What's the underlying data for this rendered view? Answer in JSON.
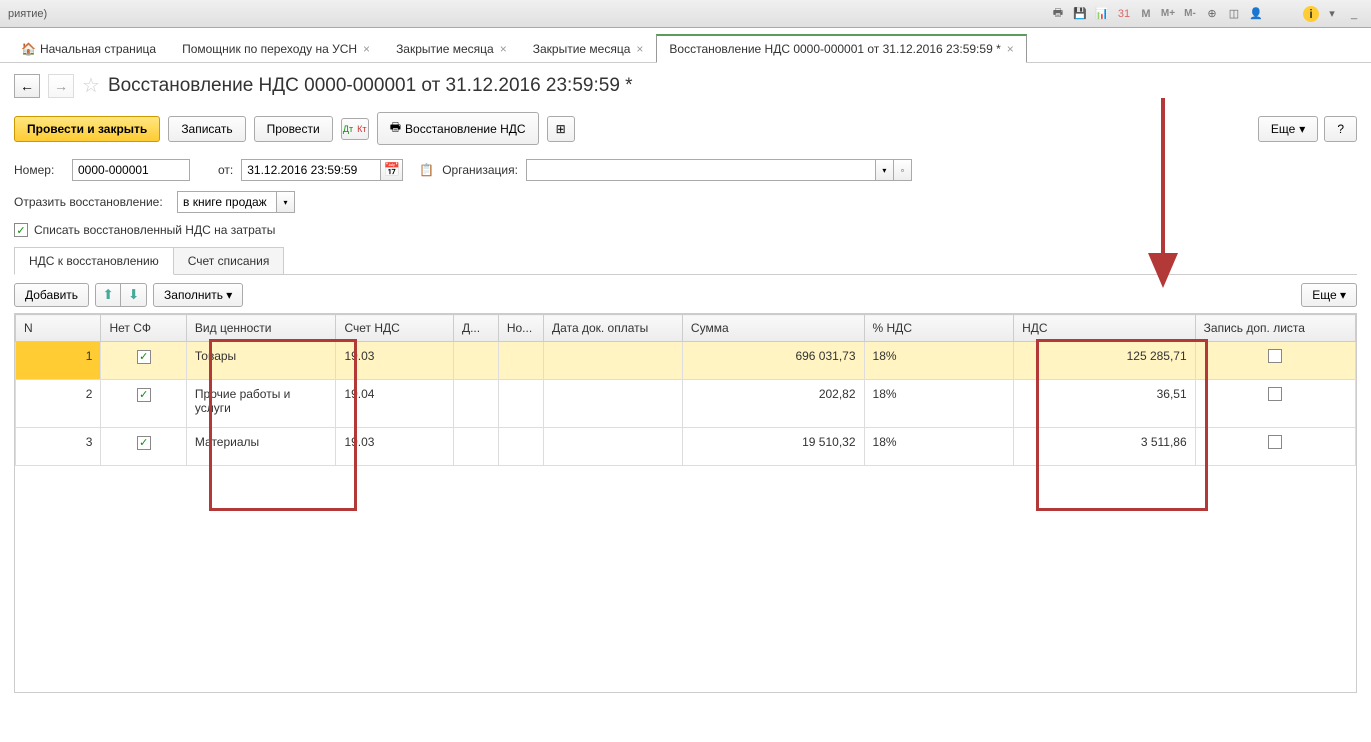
{
  "top": {
    "title_fragment": "риятие)"
  },
  "tabs": {
    "home": "Начальная страница",
    "items": [
      {
        "label": "Помощник по переходу на УСН"
      },
      {
        "label": "Закрытие месяца"
      },
      {
        "label": "Закрытие месяца"
      },
      {
        "label": "Восстановление НДС 0000-000001 от 31.12.2016 23:59:59 *",
        "active": true
      }
    ]
  },
  "title": "Восстановление НДС 0000-000001 от 31.12.2016 23:59:59 *",
  "toolbar": {
    "post_close": "Провести и закрыть",
    "save": "Записать",
    "post": "Провести",
    "print": "Восстановление НДС",
    "more": "Еще",
    "help": "?"
  },
  "form": {
    "number_label": "Номер:",
    "number_value": "0000-000001",
    "date_label": "от:",
    "date_value": "31.12.2016 23:59:59",
    "org_label": "Организация:",
    "org_value": "",
    "reflect_label": "Отразить восстановление:",
    "reflect_value": "в книге продаж",
    "write_off_label": "Списать восстановленный НДС на затраты"
  },
  "subtabs": {
    "tab1": "НДС к восстановлению",
    "tab2": "Счет списания"
  },
  "table_toolbar": {
    "add": "Добавить",
    "fill": "Заполнить",
    "more": "Еще"
  },
  "table": {
    "headers": {
      "n": "N",
      "sf": "Нет СФ",
      "vid": "Вид ценности",
      "schet": "Счет НДС",
      "d": "Д...",
      "no": "Но...",
      "date": "Дата док. оплаты",
      "sum": "Сумма",
      "pct": "% НДС",
      "nds": "НДС",
      "dop": "Запись доп. листа"
    },
    "rows": [
      {
        "n": "1",
        "sf": true,
        "vid": "Товары",
        "schet": "19.03",
        "sum": "696 031,73",
        "pct": "18%",
        "nds": "125 285,71",
        "dop": false,
        "selected": true
      },
      {
        "n": "2",
        "sf": true,
        "vid": "Прочие работы и услуги",
        "schet": "19.04",
        "sum": "202,82",
        "pct": "18%",
        "nds": "36,51",
        "dop": false
      },
      {
        "n": "3",
        "sf": true,
        "vid": "Материалы",
        "schet": "19.03",
        "sum": "19 510,32",
        "pct": "18%",
        "nds": "3 511,86",
        "dop": false
      }
    ]
  }
}
